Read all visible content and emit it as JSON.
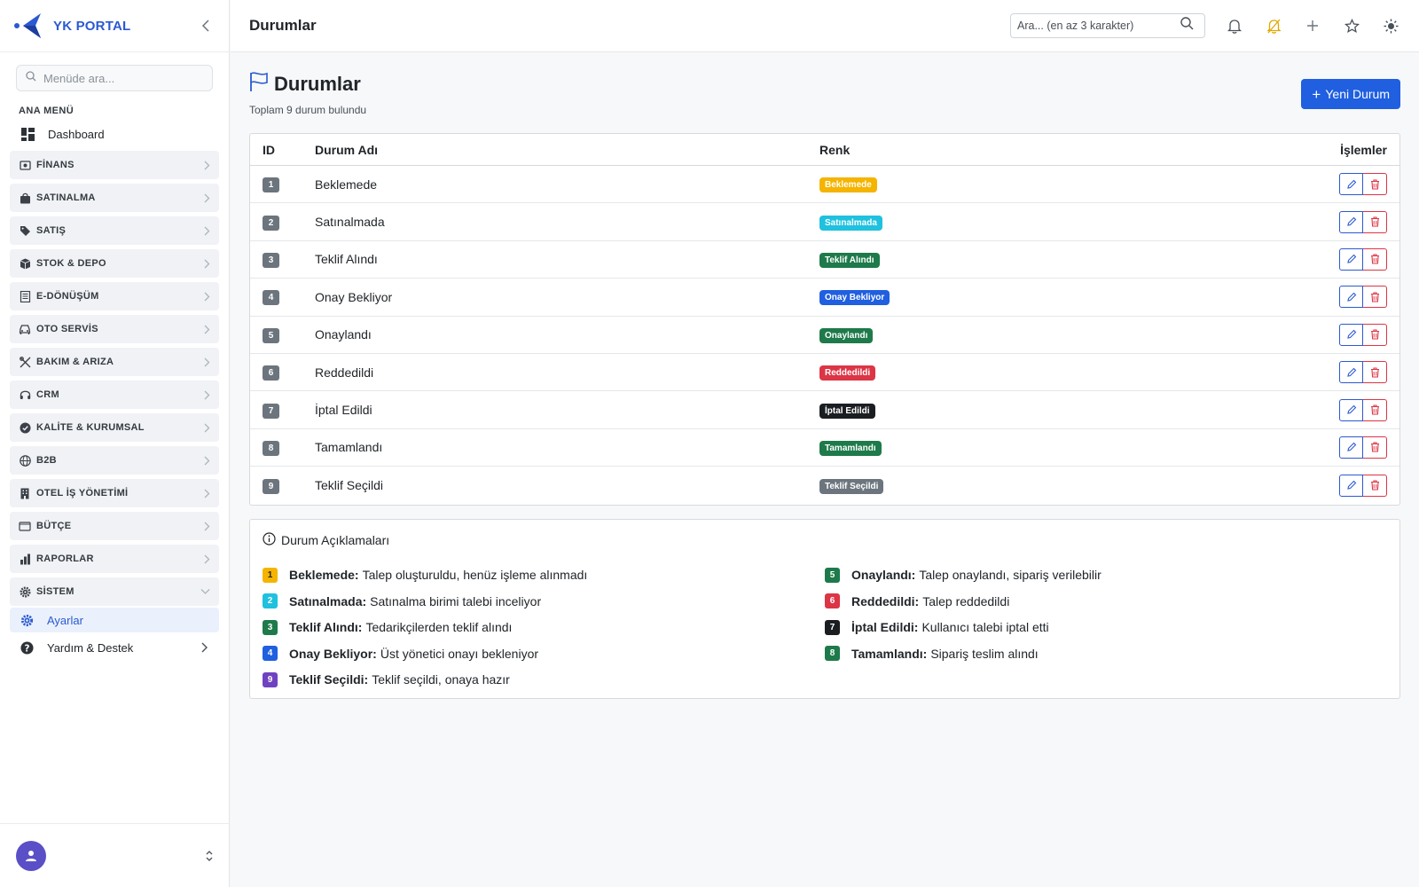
{
  "brand": {
    "name": "YK PORTAL"
  },
  "sidebar": {
    "search_placeholder": "Menüde ara...",
    "section_label": "ANA MENÜ",
    "dashboard_label": "Dashboard",
    "groups": [
      {
        "label": "FİNANS",
        "icon": "finance-icon"
      },
      {
        "label": "SATINALMA",
        "icon": "bag-icon"
      },
      {
        "label": "SATIŞ",
        "icon": "tag-icon"
      },
      {
        "label": "STOK & DEPO",
        "icon": "box-icon"
      },
      {
        "label": "E-DÖNÜŞÜM",
        "icon": "document-icon"
      },
      {
        "label": "OTO SERVİS",
        "icon": "car-icon"
      },
      {
        "label": "BAKIM & ARIZA",
        "icon": "tools-icon"
      },
      {
        "label": "CRM",
        "icon": "headset-icon"
      },
      {
        "label": "KALİTE & KURUMSAL",
        "icon": "badge-check-icon"
      },
      {
        "label": "B2B",
        "icon": "globe-icon"
      },
      {
        "label": "OTEL İŞ YÖNETİMİ",
        "icon": "building-icon"
      },
      {
        "label": "BÜTÇE",
        "icon": "wallet-icon"
      },
      {
        "label": "RAPORLAR",
        "icon": "bar-chart-icon"
      },
      {
        "label": "SİSTEM",
        "icon": "gear-icon",
        "expanded": true
      }
    ],
    "sub_items": [
      {
        "label": "Ayarlar",
        "active": true
      }
    ],
    "help_label": "Yardım & Destek"
  },
  "topbar": {
    "title": "Durumlar",
    "search_placeholder": "Ara... (en az 3 karakter)"
  },
  "page": {
    "title": "Durumlar",
    "subtitle": "Toplam 9 durum bulundu",
    "new_button_label": "Yeni Durum"
  },
  "table": {
    "headers": {
      "id": "ID",
      "name": "Durum Adı",
      "color": "Renk",
      "actions": "İşlemler"
    },
    "rows": [
      {
        "id": "1",
        "name": "Beklemede",
        "badge": "Beklemede",
        "color": "#f5b400"
      },
      {
        "id": "2",
        "name": "Satınalmada",
        "badge": "Satınalmada",
        "color": "#1fc1df"
      },
      {
        "id": "3",
        "name": "Teklif Alındı",
        "badge": "Teklif Alındı",
        "color": "#1e7a4a"
      },
      {
        "id": "4",
        "name": "Onay Bekliyor",
        "badge": "Onay Bekliyor",
        "color": "#1f5fe0"
      },
      {
        "id": "5",
        "name": "Onaylandı",
        "badge": "Onaylandı",
        "color": "#1e7a4a"
      },
      {
        "id": "6",
        "name": "Reddedildi",
        "badge": "Reddedildi",
        "color": "#dc3545"
      },
      {
        "id": "7",
        "name": "İptal Edildi",
        "badge": "İptal Edildi",
        "color": "#1b1e21"
      },
      {
        "id": "8",
        "name": "Tamamlandı",
        "badge": "Tamamlandı",
        "color": "#1e7a4a"
      },
      {
        "id": "9",
        "name": "Teklif Seçildi",
        "badge": "Teklif Seçildi",
        "color": "#6c757d"
      }
    ]
  },
  "legend": {
    "title": "Durum Açıklamaları",
    "left": [
      {
        "num": "1",
        "name": "Beklemede:",
        "desc": "Talep oluşturuldu, henüz işleme alınmadı",
        "color": "#f5b400",
        "text_color": "#212529"
      },
      {
        "num": "2",
        "name": "Satınalmada:",
        "desc": "Satınalma birimi talebi inceliyor",
        "color": "#1fc1df",
        "text_color": "#ffffff"
      },
      {
        "num": "3",
        "name": "Teklif Alındı:",
        "desc": "Tedarikçilerden teklif alındı",
        "color": "#1e7a4a",
        "text_color": "#ffffff"
      },
      {
        "num": "4",
        "name": "Onay Bekliyor:",
        "desc": "Üst yönetici onayı bekleniyor",
        "color": "#1f5fe0",
        "text_color": "#ffffff"
      },
      {
        "num": "9",
        "name": "Teklif Seçildi:",
        "desc": "Teklif seçildi, onaya hazır",
        "color": "#6f42c1",
        "text_color": "#ffffff"
      }
    ],
    "right": [
      {
        "num": "5",
        "name": "Onaylandı:",
        "desc": "Talep onaylandı, sipariş verilebilir",
        "color": "#1e7a4a",
        "text_color": "#ffffff"
      },
      {
        "num": "6",
        "name": "Reddedildi:",
        "desc": "Talep reddedildi",
        "color": "#dc3545",
        "text_color": "#ffffff"
      },
      {
        "num": "7",
        "name": "İptal Edildi:",
        "desc": "Kullanıcı talebi iptal etti",
        "color": "#1b1e21",
        "text_color": "#ffffff"
      },
      {
        "num": "8",
        "name": "Tamamlandı:",
        "desc": "Sipariş teslim alındı",
        "color": "#1e7a4a",
        "text_color": "#ffffff"
      }
    ]
  },
  "colors": {
    "primary": "#1f5fe0",
    "danger": "#dc3545",
    "brand": "#2b59d1"
  }
}
